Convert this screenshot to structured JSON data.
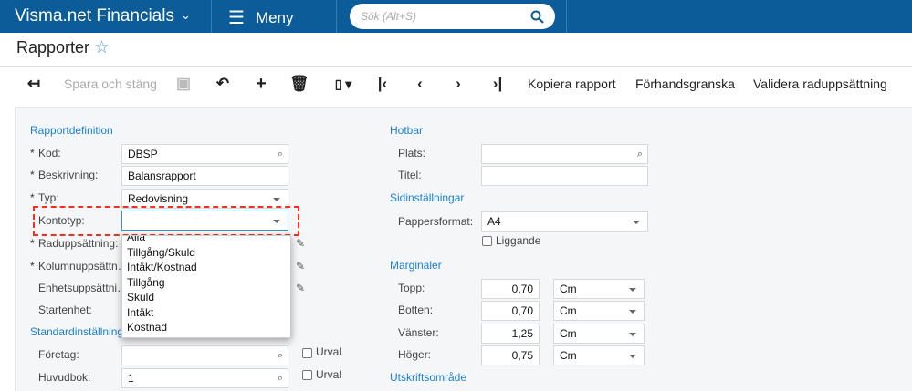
{
  "topbar": {
    "app_title": "Visma.net Financials",
    "menu_label": "Meny",
    "search_placeholder": "Sök (Alt+S)"
  },
  "page": {
    "title": "Rapporter"
  },
  "toolbar": {
    "save_close": "Spara och stäng",
    "copy_report": "Kopiera rapport",
    "preview": "Förhandsgranska",
    "validate": "Validera raduppsättning"
  },
  "left": {
    "section1": "Rapportdefinition",
    "kod_label": "Kod:",
    "kod_value": "DBSP",
    "beskrivning_label": "Beskrivning:",
    "beskrivning_value": "Balansrapport",
    "typ_label": "Typ:",
    "typ_value": "Redovisning",
    "kontotyp_label": "Kontotyp:",
    "kontotyp_value": "",
    "raduppsattning_label": "Raduppsättning:",
    "kolumn_label": "Kolumnuppsättn…",
    "enhet_label": "Enhetsuppsättni…",
    "startenhet_label": "Startenhet:",
    "section2": "Standardinställningar",
    "foretag_label": "Företag:",
    "foretag_value": "",
    "huvudbok_label": "Huvudbok:",
    "huvudbok_value": "1",
    "urval_label": "Urval",
    "kontotyp_options": [
      "Alla",
      "Tillgång/Skuld",
      "Intäkt/Kostnad",
      "Tillgång",
      "Skuld",
      "Intäkt",
      "Kostnad"
    ]
  },
  "right": {
    "hotbar": "Hotbar",
    "plats_label": "Plats:",
    "titel_label": "Titel:",
    "sidinst": "Sidinställningar",
    "pappersformat_label": "Pappersformat:",
    "pappersformat_value": "A4",
    "liggande_label": "Liggande",
    "marginaler": "Marginaler",
    "margins": [
      {
        "label": "Topp:",
        "value": "0,70",
        "unit": "Cm"
      },
      {
        "label": "Botten:",
        "value": "0,70",
        "unit": "Cm"
      },
      {
        "label": "Vänster:",
        "value": "1,25",
        "unit": "Cm"
      },
      {
        "label": "Höger:",
        "value": "0,75",
        "unit": "Cm"
      }
    ],
    "utskrift": "Utskriftsområde"
  }
}
